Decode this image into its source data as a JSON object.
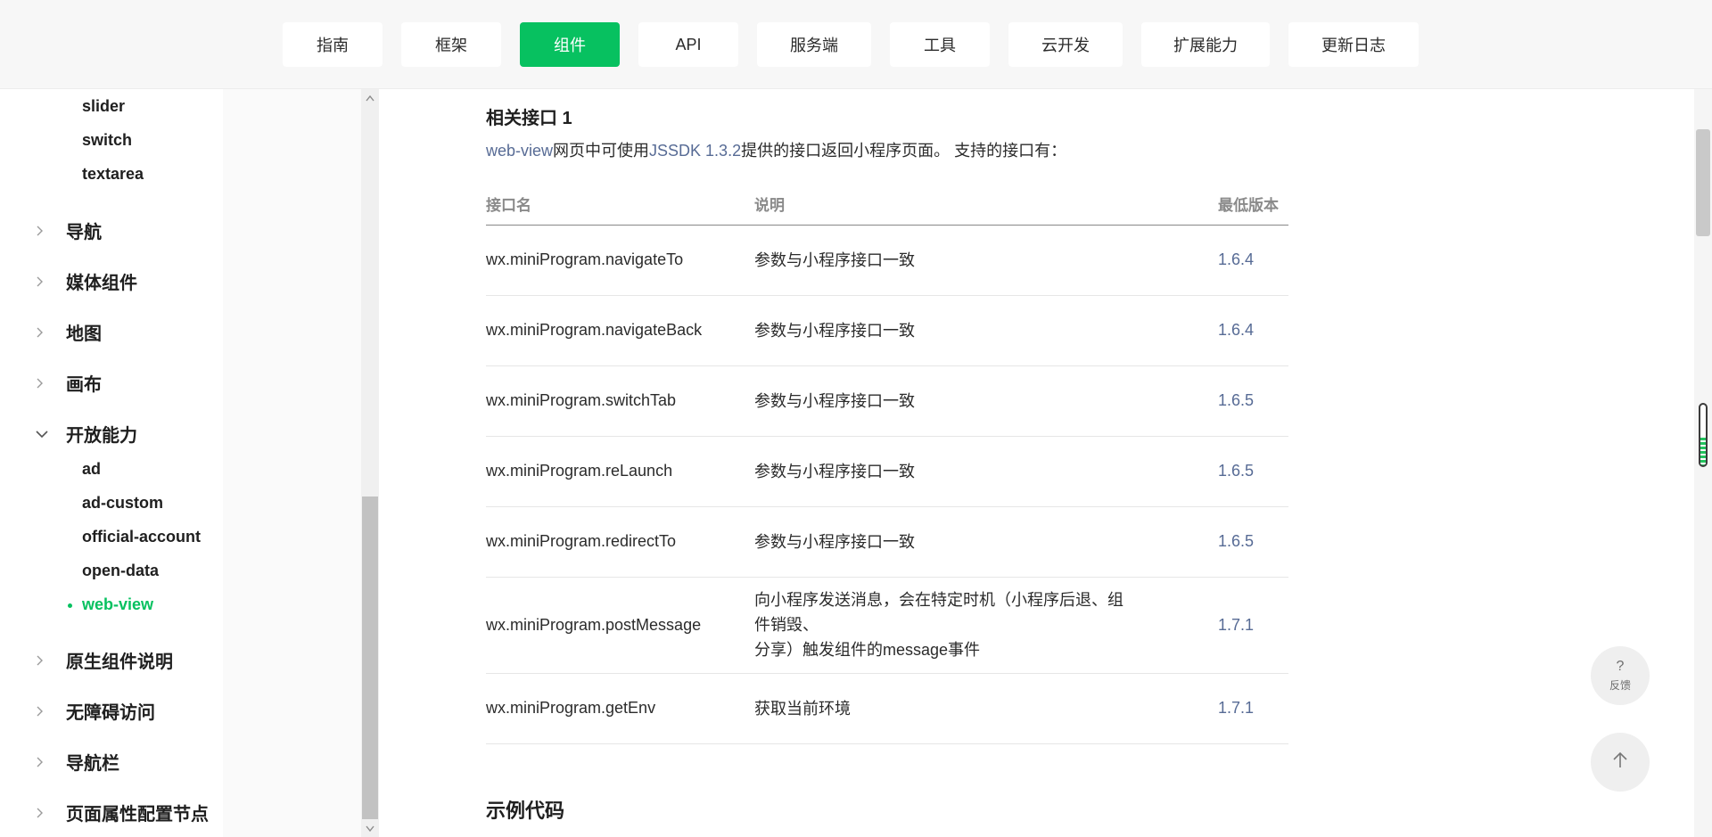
{
  "top_nav": {
    "items": [
      {
        "label": "指南"
      },
      {
        "label": "框架"
      },
      {
        "label": "组件",
        "active": true
      },
      {
        "label": "API"
      },
      {
        "label": "服务端"
      },
      {
        "label": "工具"
      },
      {
        "label": "云开发"
      },
      {
        "label": "扩展能力"
      },
      {
        "label": "更新日志"
      }
    ]
  },
  "sidebar": {
    "form_subitems": [
      "slider",
      "switch",
      "textarea"
    ],
    "groups_before": [
      "导航",
      "媒体组件",
      "地图",
      "画布"
    ],
    "open_group": "开放能力",
    "open_subitems": [
      "ad",
      "ad-custom",
      "official-account",
      "open-data",
      "web-view"
    ],
    "active_subitem": "web-view",
    "groups_after": [
      "原生组件说明",
      "无障碍访问",
      "导航栏",
      "页面属性配置节点"
    ]
  },
  "content": {
    "section_title": "相关接口 1",
    "intro": {
      "link1": "web-view",
      "text1": "网页中可使用",
      "link2": "JSSDK 1.3.2",
      "text2": "提供的接口返回小程序页面。 支持的接口有："
    },
    "table": {
      "headers": [
        "接口名",
        "说明",
        "最低版本"
      ],
      "rows": [
        {
          "name": "wx.miniProgram.navigateTo",
          "desc_line1": "参数与小程序接口一致",
          "desc_line2": "",
          "version": "1.6.4"
        },
        {
          "name": "wx.miniProgram.navigateBack",
          "desc_line1": "参数与小程序接口一致",
          "desc_line2": "",
          "version": "1.6.4"
        },
        {
          "name": "wx.miniProgram.switchTab",
          "desc_line1": "参数与小程序接口一致",
          "desc_line2": "",
          "version": "1.6.5"
        },
        {
          "name": "wx.miniProgram.reLaunch",
          "desc_line1": "参数与小程序接口一致",
          "desc_line2": "",
          "version": "1.6.5"
        },
        {
          "name": "wx.miniProgram.redirectTo",
          "desc_line1": "参数与小程序接口一致",
          "desc_line2": "",
          "version": "1.6.5"
        },
        {
          "name": "wx.miniProgram.postMessage",
          "desc_line1": "向小程序发送消息，会在特定时机（小程序后退、组件销毁、",
          "desc_line2": "分享）触发组件的message事件",
          "version": "1.7.1"
        },
        {
          "name": "wx.miniProgram.getEnv",
          "desc_line1": "获取当前环境",
          "desc_line2": "",
          "version": "1.7.1"
        }
      ]
    },
    "example_title": "示例代码"
  },
  "floating": {
    "feedback_symbol": "?",
    "feedback_label": "反馈",
    "back_to_top_icon": "arrow-up-icon"
  },
  "colors": {
    "accent": "#07c160",
    "link": "#576b95"
  }
}
